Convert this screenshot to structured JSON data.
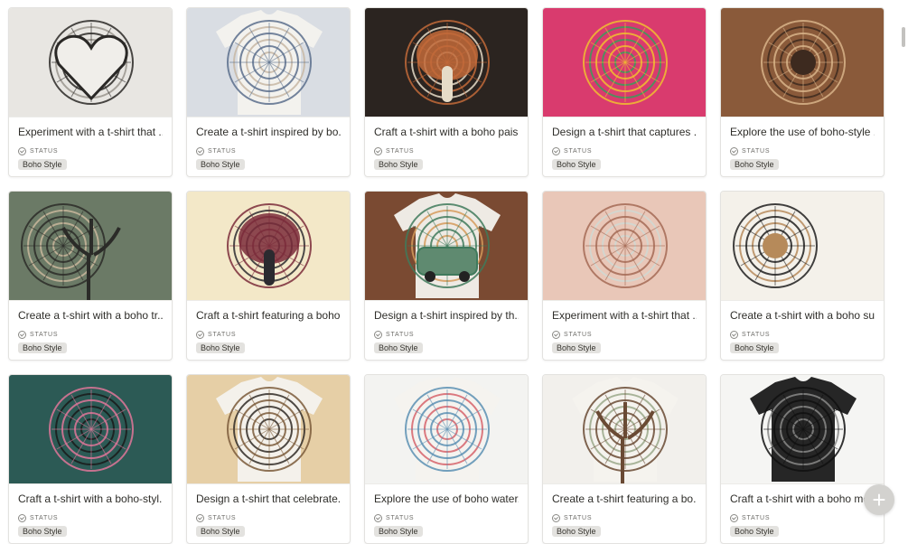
{
  "cards": [
    {
      "title": "Experiment with a t-shirt that ...",
      "status_label": "STATUS",
      "tag": "Boho Style",
      "thumb": "heart-arrows-sketch",
      "palette": [
        "#e8e6e2",
        "#2a2826",
        "#9a958e"
      ]
    },
    {
      "title": "Create a t-shirt inspired by bo...",
      "status_label": "STATUS",
      "tag": "Boho Style",
      "thumb": "tie-dye-blue-tee",
      "palette": [
        "#d9dde3",
        "#5a6f8c",
        "#c7b7a3"
      ]
    },
    {
      "title": "Craft a t-shirt with a boho pais...",
      "status_label": "STATUS",
      "tag": "Boho Style",
      "thumb": "paisley-elephant",
      "palette": [
        "#2b2420",
        "#c26a3a",
        "#e6dcc8"
      ]
    },
    {
      "title": "Design a t-shirt that captures ...",
      "status_label": "STATUS",
      "tag": "Boho Style",
      "thumb": "rainbow-dreamcatcher",
      "palette": [
        "#d93b6e",
        "#f0c030",
        "#3a9c5c"
      ]
    },
    {
      "title": "Explore the use of boho-style ...",
      "status_label": "STATUS",
      "tag": "Boho Style",
      "thumb": "sun-moon-brown",
      "palette": [
        "#8a5a3a",
        "#d8b48a",
        "#3d2a1f"
      ]
    },
    {
      "title": "Create a t-shirt with a boho tr...",
      "status_label": "STATUS",
      "tag": "Boho Style",
      "thumb": "tree-dreamcatcher",
      "palette": [
        "#6b7a66",
        "#2b2b28",
        "#c9b79c"
      ]
    },
    {
      "title": "Craft a t-shirt featuring a boho...",
      "status_label": "STATUS",
      "tag": "Boho Style",
      "thumb": "mandala-elephant",
      "palette": [
        "#f3e8c8",
        "#7a2b3a",
        "#2b2a2f"
      ]
    },
    {
      "title": "Design a t-shirt inspired by th...",
      "status_label": "STATUS",
      "tag": "Boho Style",
      "thumb": "van-tee",
      "palette": [
        "#7a4a32",
        "#3f7a5c",
        "#d59a5a"
      ]
    },
    {
      "title": "Experiment with a t-shirt that ...",
      "status_label": "STATUS",
      "tag": "Boho Style",
      "thumb": "feathers-clouds",
      "palette": [
        "#e9c7b8",
        "#a46a55",
        "#cfd8d2"
      ]
    },
    {
      "title": "Create a t-shirt with a boho su...",
      "status_label": "STATUS",
      "tag": "Boho Style",
      "thumb": "sun-waves",
      "palette": [
        "#f4f1ea",
        "#1f1f1f",
        "#b68a5a"
      ]
    },
    {
      "title": "Craft a t-shirt with a boho-styl...",
      "status_label": "STATUS",
      "tag": "Boho Style",
      "thumb": "lotus-mandala",
      "palette": [
        "#2c5a55",
        "#e0779a",
        "#1a1a1a"
      ]
    },
    {
      "title": "Design a t-shirt that celebrate...",
      "status_label": "STATUS",
      "tag": "Boho Style",
      "thumb": "yoga-meditation",
      "palette": [
        "#e6cfa6",
        "#7a5a3a",
        "#2f2a26"
      ]
    },
    {
      "title": "Explore the use of boho water...",
      "status_label": "STATUS",
      "tag": "Boho Style",
      "thumb": "watercolor-mandala",
      "palette": [
        "#f3f3f1",
        "#5a8fb3",
        "#d6616a"
      ]
    },
    {
      "title": "Create a t-shirt featuring a bo...",
      "status_label": "STATUS",
      "tag": "Boho Style",
      "thumb": "tree-of-life-tee",
      "palette": [
        "#f2f0ec",
        "#6a4a34",
        "#9aa88a"
      ]
    },
    {
      "title": "Craft a t-shirt with a boho mo...",
      "status_label": "STATUS",
      "tag": "Boho Style",
      "thumb": "monochrome-mandala",
      "palette": [
        "#f5f5f3",
        "#111111",
        "#8a8a88"
      ]
    }
  ],
  "fab": {
    "icon": "plus-icon",
    "label": "+"
  }
}
